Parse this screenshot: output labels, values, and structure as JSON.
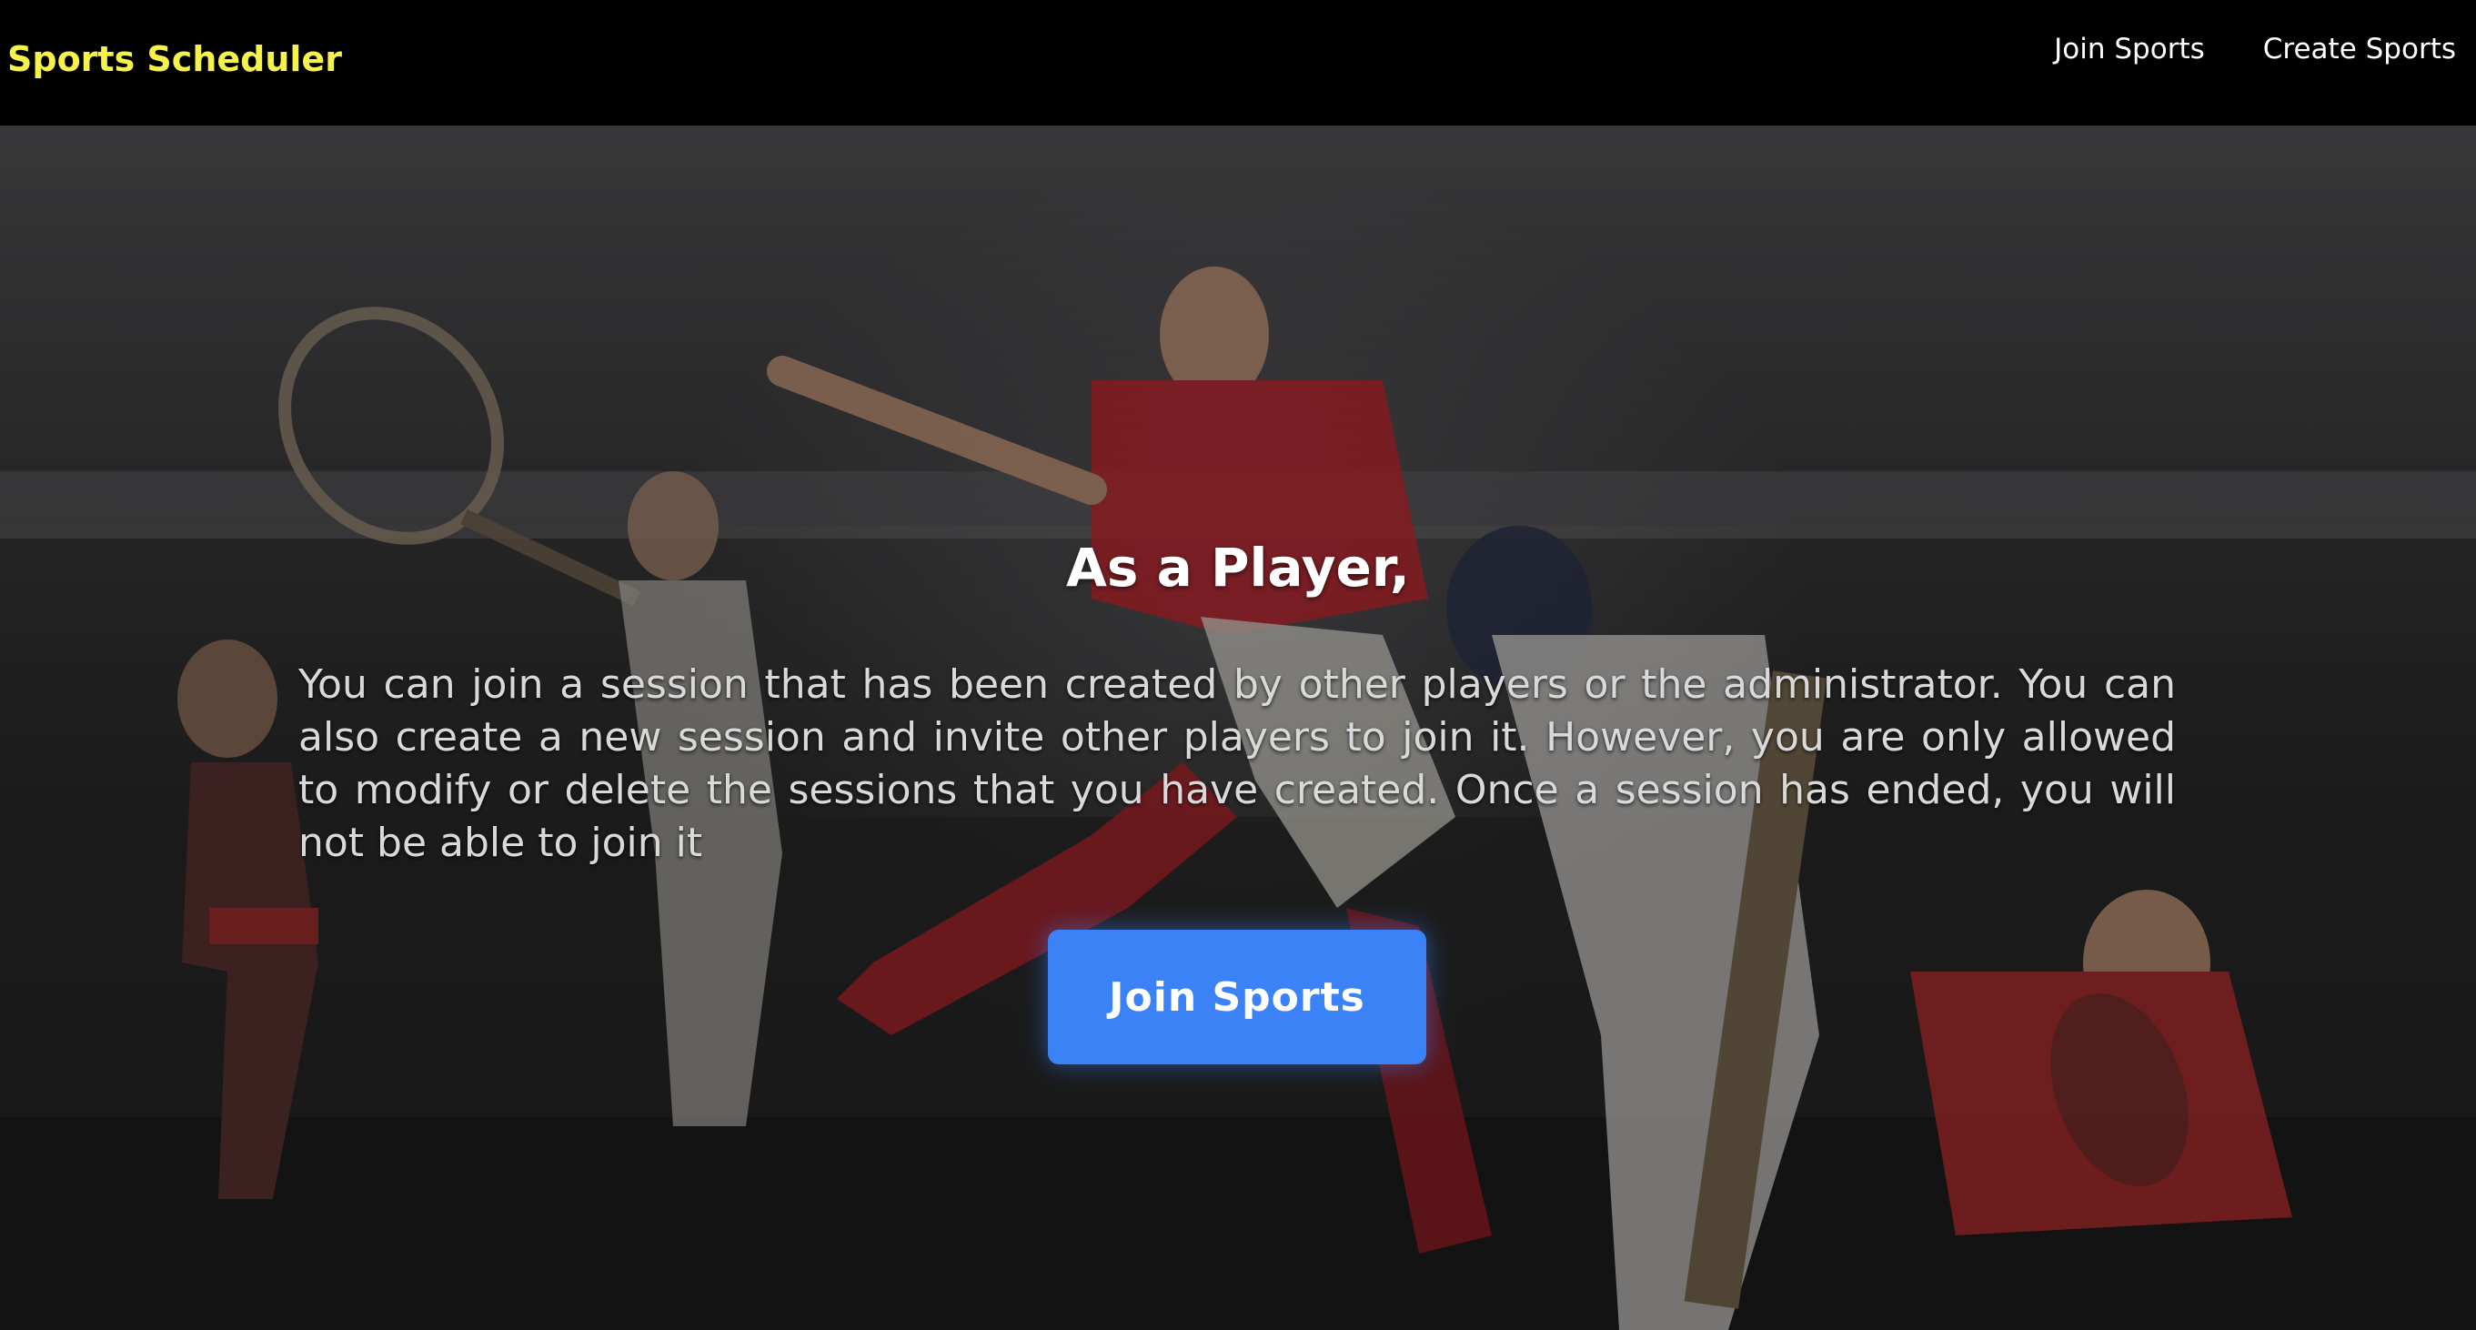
{
  "navbar": {
    "brand": "Sports Scheduler",
    "links": [
      "Join Sports",
      "Create Sports"
    ]
  },
  "hero": {
    "title": "As a Player,",
    "description": "You can join a session that has been created by other players or the administrator. You can also create a new session and invite other players to join it. However, you are only allowed to modify or delete the sessions that you have created. Once a session has ended, you will not be able to join it",
    "cta_label": "Join Sports"
  },
  "colors": {
    "navbar_bg": "#000000",
    "brand": "#f5f24b",
    "cta": "#3b82f6"
  }
}
